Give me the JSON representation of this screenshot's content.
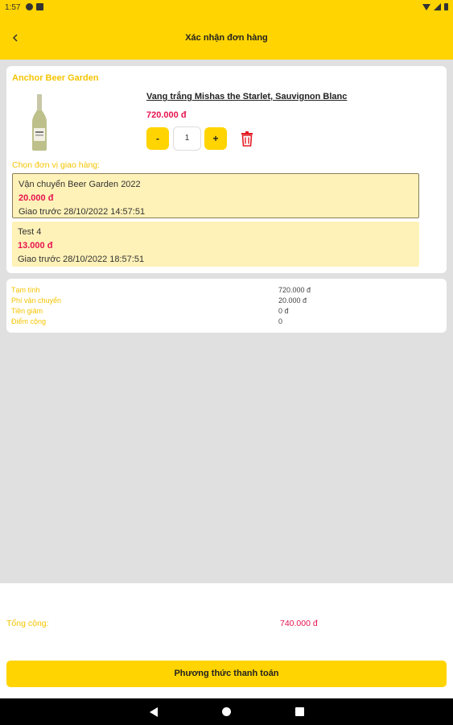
{
  "status_bar": {
    "time": "1:57"
  },
  "app_bar": {
    "title": "Xác nhận đơn hàng"
  },
  "store": {
    "name": "Anchor Beer Garden"
  },
  "product": {
    "name": "Vang trắng Mishas the Starlet, Sauvignon Blanc",
    "price": "720.000 đ",
    "quantity": "1",
    "minus_label": "-",
    "plus_label": "+"
  },
  "shipping": {
    "label": "Chọn đơn vị giao hàng:",
    "options": [
      {
        "name": "Vận chuyển Beer Garden 2022",
        "price": "20.000 đ",
        "date": "Giao trước 28/10/2022 14:57:51",
        "selected": true
      },
      {
        "name": "Test 4",
        "price": "13.000 đ",
        "date": "Giao trước 28/10/2022 18:57:51",
        "selected": false
      }
    ]
  },
  "summary": {
    "rows": [
      {
        "label": "Tạm tính",
        "value": "720.000 đ"
      },
      {
        "label": "Phí vận chuyển",
        "value": "20.000 đ"
      },
      {
        "label": "Tiền giảm",
        "value": "0 đ"
      },
      {
        "label": "Điểm cộng",
        "value": "0"
      }
    ]
  },
  "total": {
    "label": "Tổng cộng:",
    "value": "740.000 đ"
  },
  "payment_button": {
    "label": "Phương thức thanh toán"
  },
  "colors": {
    "accent": "#ffd400",
    "price": "#e6134f",
    "label": "#f5c400"
  },
  "icons": {
    "back": "chevron-left-icon",
    "trash": "trash-icon",
    "nav_back": "nav-back-icon",
    "nav_home": "nav-home-icon",
    "nav_recent": "nav-recent-icon"
  }
}
